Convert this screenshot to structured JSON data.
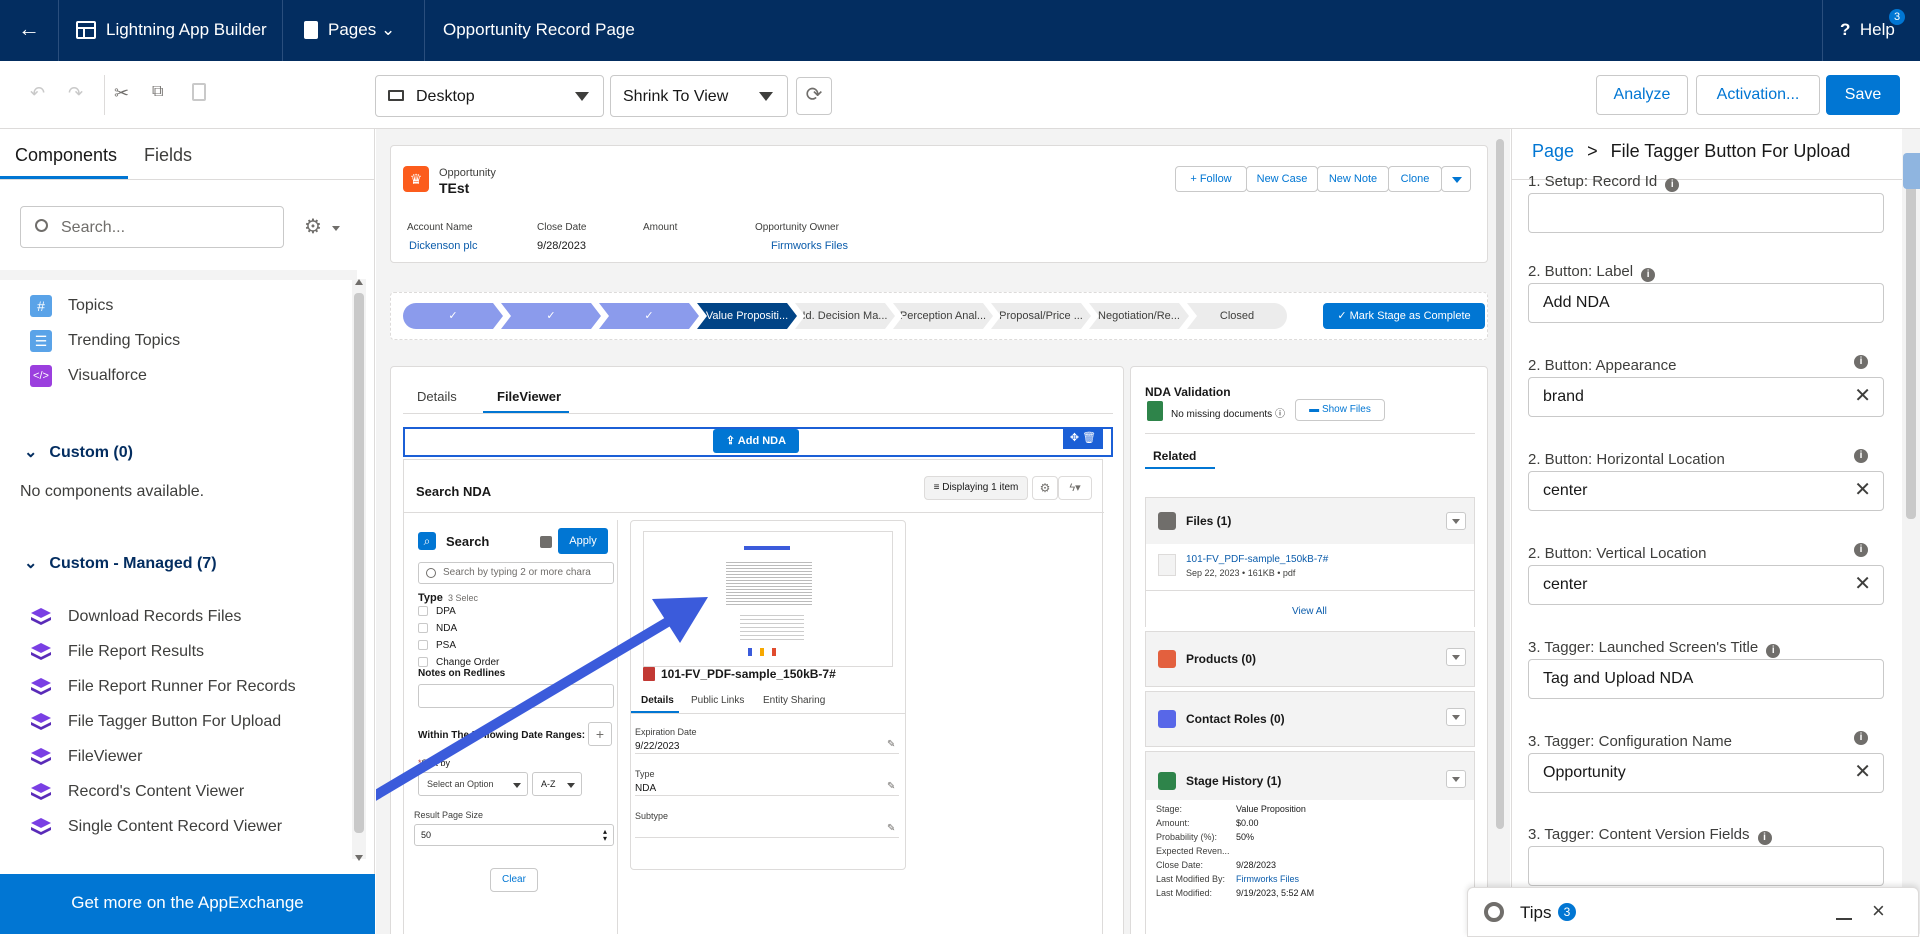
{
  "topbar": {
    "back_label": "←",
    "app_title": "Lightning App Builder",
    "pages_label": "Pages",
    "page_name": "Opportunity Record Page",
    "help_label": "Help",
    "help_badge": "3"
  },
  "toolbar": {
    "device": "Desktop",
    "view_mode": "Shrink To View",
    "analyze_label": "Analyze",
    "activation_label": "Activation...",
    "save_label": "Save"
  },
  "left_panel": {
    "tabs": [
      "Components",
      "Fields"
    ],
    "search_placeholder": "Search...",
    "standard_items": [
      {
        "label": "Topics",
        "icon": "hash-icon"
      },
      {
        "label": "Trending Topics",
        "icon": "list-icon"
      },
      {
        "label": "Visualforce",
        "icon": "code-icon"
      }
    ],
    "custom_header": "Custom (0)",
    "custom_empty": "No components available.",
    "managed_header": "Custom - Managed (7)",
    "managed_items": [
      "Download Records Files",
      "File Report Results",
      "File Report Runner For Records",
      "File Tagger Button For Upload",
      "FileViewer",
      "Record's Content Viewer",
      "Single Content Record Viewer"
    ],
    "appexchange_label": "Get more on the AppExchange"
  },
  "record_header": {
    "object": "Opportunity",
    "name": "TEst",
    "actions": [
      "+ Follow",
      "New Case",
      "New Note",
      "Clone"
    ],
    "fields": [
      {
        "label": "Account Name",
        "value": "Dickenson plc"
      },
      {
        "label": "Close Date",
        "value": "9/28/2023"
      },
      {
        "label": "Amount",
        "value": ""
      },
      {
        "label": "Opportunity Owner",
        "value": "Firmworks Files"
      }
    ]
  },
  "path": {
    "stages": [
      "✓",
      "✓",
      "✓",
      "Value Propositi...",
      "Id. Decision Ma...",
      "Perception Anal...",
      "Proposal/Price ...",
      "Negotiation/Re...",
      "Closed"
    ],
    "complete_label": "Mark Stage as Complete"
  },
  "main_tabs": [
    "Details",
    "FileViewer"
  ],
  "add_nda_label": "Add NDA",
  "search_nda": {
    "title": "Search NDA",
    "displaying": "Displaying 1 item",
    "search_label": "Search",
    "apply_label": "Apply",
    "search_placeholder": "Search by typing 2 or more chara",
    "type_label": "Type",
    "type_selected": "3 Selec",
    "type_options": [
      "DPA",
      "NDA",
      "PSA",
      "Change Order"
    ],
    "notes_label": "Notes on Redlines",
    "date_ranges_label": "Within The Following Date Ranges:",
    "sort_label": "Sort by",
    "sort_placeholder": "Select an Option",
    "sort_dir": "A-Z",
    "page_size_label": "Result Page Size",
    "page_size": "50",
    "clear_label": "Clear",
    "file_name": "101-FV_PDF-sample_150kB-7#",
    "file_tabs": [
      "Details",
      "Public Links",
      "Entity Sharing"
    ],
    "file_fields": [
      {
        "label": "Expiration Date",
        "value": "9/22/2023"
      },
      {
        "label": "Type",
        "value": "NDA"
      },
      {
        "label": "Subtype",
        "value": ""
      }
    ]
  },
  "sidebar_card": {
    "nda_title": "NDA Validation",
    "nda_status": "No missing documents",
    "show_files": "Show Files",
    "related_tab": "Related",
    "files_header": "Files (1)",
    "file_link": "101-FV_PDF-sample_150kB-7#",
    "file_meta": "Sep 22, 2023 • 161KB • pdf",
    "view_all": "View All",
    "products_header": "Products (0)",
    "contact_roles_header": "Contact Roles (0)",
    "stage_history_header": "Stage History (1)",
    "stage_rows": [
      {
        "label": "Stage:",
        "value": "Value Proposition"
      },
      {
        "label": "Amount:",
        "value": "$0.00"
      },
      {
        "label": "Probability (%):",
        "value": "50%"
      },
      {
        "label": "Expected Reven...",
        "value": ""
      },
      {
        "label": "Close Date:",
        "value": "9/28/2023"
      },
      {
        "label": "Last Modified By:",
        "value": "Firmworks Files"
      },
      {
        "label": "Last Modified:",
        "value": "9/19/2023, 5:52 AM"
      }
    ]
  },
  "properties": {
    "breadcrumb_root": "Page",
    "breadcrumb_sep": ">",
    "breadcrumb_current": "File Tagger Button For Upload",
    "fields": [
      {
        "label": "1. Setup: Record Id",
        "value": "",
        "clear": false
      },
      {
        "label": "2. Button: Label",
        "value": "Add NDA",
        "clear": false
      },
      {
        "label": "2. Button: Appearance",
        "value": "brand",
        "clear": true
      },
      {
        "label": "2. Button: Horizontal Location",
        "value": "center",
        "clear": true
      },
      {
        "label": "2. Button: Vertical Location",
        "value": "center",
        "clear": true
      },
      {
        "label": "3. Tagger: Launched Screen's Title",
        "value": "Tag and Upload NDA",
        "clear": false
      },
      {
        "label": "3. Tagger: Configuration Name",
        "value": "Opportunity",
        "clear": true
      },
      {
        "label": "3. Tagger: Content Version Fields",
        "value": "",
        "clear": false
      }
    ]
  },
  "tips": {
    "label": "Tips",
    "count": "3"
  },
  "colors": {
    "navy": "#032d60",
    "brand": "#0176d3",
    "arrow": "#3b5bdb",
    "path_done": "#8b9bec",
    "path_current": "#014486"
  }
}
